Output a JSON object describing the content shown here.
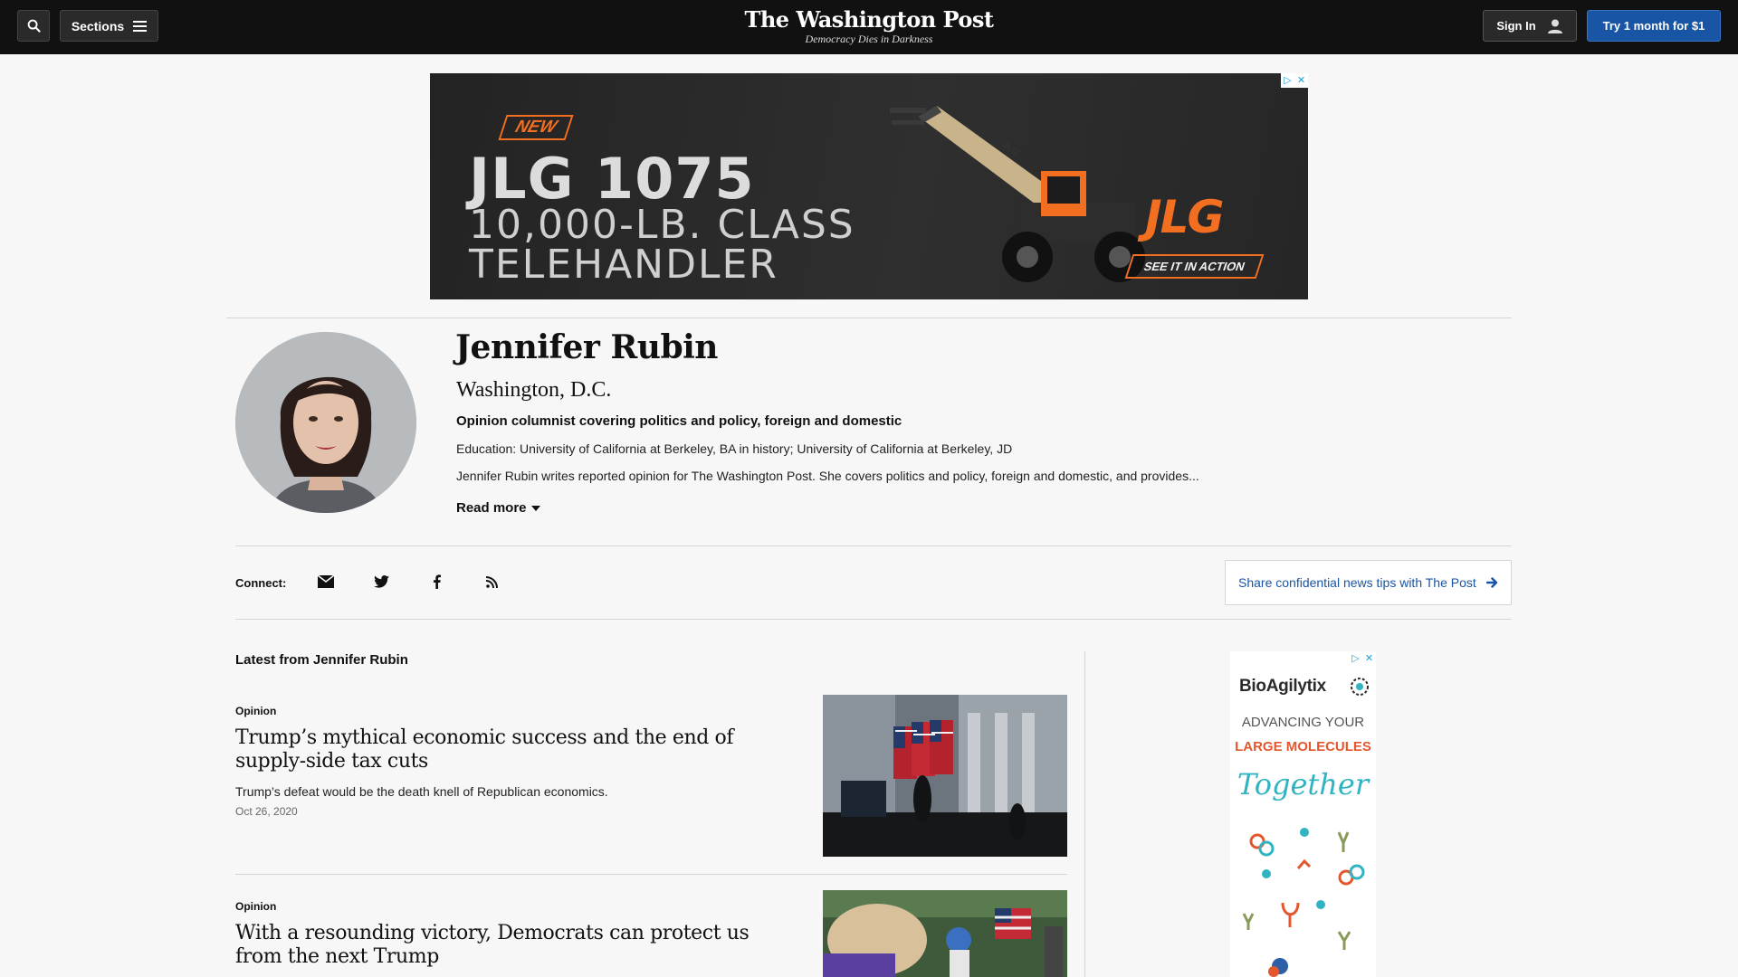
{
  "header": {
    "sections_label": "Sections",
    "logo": "The Washington Post",
    "tagline": "Democracy Dies in Darkness",
    "signin_label": "Sign In",
    "trial_label": "Try 1 month for $1"
  },
  "ad_banner": {
    "badge": "NEW",
    "model": "JLG 1075",
    "line1": "10,000-LB. CLASS",
    "line2": "TELEHANDLER",
    "brand": "JLG",
    "cta": "SEE IT IN ACTION",
    "machine_label": "JLG"
  },
  "author": {
    "name": "Jennifer Rubin",
    "location": "Washington, D.C.",
    "role": "Opinion columnist covering politics and policy, foreign and domestic",
    "education": "Education: University of California at Berkeley, BA in history; University of California at Berkeley, JD",
    "bio": "Jennifer Rubin writes reported opinion for The Washington Post. She covers politics and policy, foreign and domestic, and provides...",
    "read_more": "Read more"
  },
  "connect": {
    "label": "Connect:",
    "icons": [
      "envelope-icon",
      "twitter-icon",
      "facebook-icon",
      "rss-icon"
    ],
    "tips_label": "Share confidential news tips with The Post"
  },
  "latest": {
    "heading": "Latest from Jennifer Rubin",
    "articles": [
      {
        "kicker": "Opinion",
        "headline": "Trump’s mythical economic success and the end of supply-side tax cuts",
        "blurb": "Trump’s defeat would be the death knell of Republican economics.",
        "date": "Oct 26, 2020"
      },
      {
        "kicker": "Opinion",
        "headline": "With a resounding victory, Democrats can protect us from the next Trump"
      }
    ]
  },
  "side_ad": {
    "brand": "BioAgilytix",
    "line1": "ADVANCING YOUR",
    "line2": "LARGE MOLECULES",
    "line3": "Together"
  },
  "colors": {
    "header_bg": "#111111",
    "accent_blue": "#1955a5",
    "ad_orange": "#f26f21",
    "side_ad_teal": "#31b3c1"
  }
}
